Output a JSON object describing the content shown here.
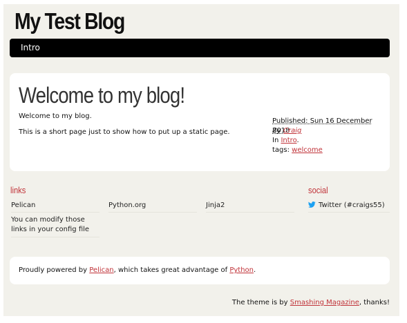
{
  "site": {
    "title": "My Test Blog"
  },
  "nav": {
    "items": [
      {
        "label": "Intro"
      }
    ]
  },
  "article": {
    "title": "Welcome to my blog!",
    "paragraphs": [
      "Welcome to my blog.",
      "This is a short page just to show how to put up a static page."
    ],
    "meta": {
      "published": "Published: Sun 16 December 2018",
      "by_label": "By ",
      "author": "Craig",
      "in_label": "In ",
      "category": "Intro",
      "category_suffix": ".",
      "tags_label": "tags: ",
      "tags": [
        "welcome"
      ]
    }
  },
  "blogroll": {
    "heading": "links",
    "links": [
      "Pelican",
      "Python.org",
      "Jinja2"
    ],
    "note": "You can modify those links in your config file"
  },
  "social": {
    "heading": "social",
    "items": [
      {
        "label": "Twitter (#craigs55)",
        "icon": "twitter-icon"
      }
    ]
  },
  "footer": {
    "prefix": "Proudly powered by ",
    "pelican": "Pelican",
    "middle": ", which takes great advantage of ",
    "python": "Python",
    "suffix": ".",
    "theme_prefix": "The theme is by ",
    "theme_link": "Smashing Magazine",
    "theme_suffix": ", thanks!"
  },
  "colors": {
    "page_background": "#f2f1eb",
    "nav_background": "#000000",
    "accent": "#c03238",
    "twitter": "#1da1f2"
  }
}
